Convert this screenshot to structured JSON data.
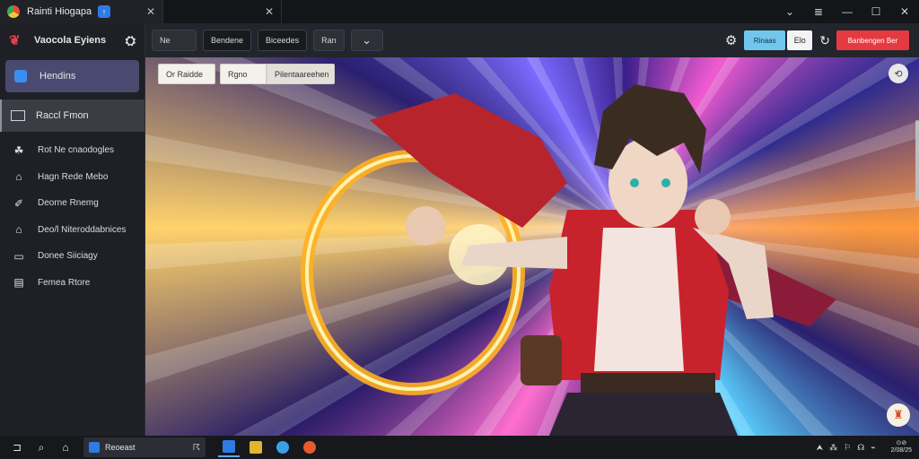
{
  "tabs": [
    {
      "label": "Rainti Hiogapa",
      "badge": "↑",
      "close": "✕"
    },
    {
      "label": "",
      "close": "✕"
    }
  ],
  "window_controls": {
    "chevron": "⌄",
    "menu": "≣",
    "minimize": "—",
    "maximize": "☐",
    "close": "✕"
  },
  "sidebar": {
    "brand": {
      "label": "Vaocola Eyiens",
      "logo": "❦",
      "icon": "⛭"
    },
    "primary": {
      "label": "Hendins"
    },
    "selected": {
      "label": "Raccl Fmon"
    },
    "items": [
      {
        "label": "Rot Ne cnaodogles",
        "icon": "☘"
      },
      {
        "label": "Hagn Rede Mebo",
        "icon": "⌂"
      },
      {
        "label": "Deorne Rnemg",
        "icon": "✐"
      },
      {
        "label": "Deo/l Niteroddabnices",
        "icon": "⌂"
      },
      {
        "label": "Donee Siiciagy",
        "icon": "▭"
      },
      {
        "label": "Femea Rtore",
        "icon": "▤"
      }
    ]
  },
  "toolbar": {
    "buttons": [
      "Ne",
      "Bendene",
      "Biceedes",
      "Ran"
    ],
    "chevron": "⌄",
    "gear": "⚙",
    "blue_label": "Rinaas",
    "white_label": "Elo",
    "refresh": "↻",
    "red_label": "Banbengen  Ber"
  },
  "canvas": {
    "chips": [
      "Or Raidde",
      "Rgno",
      "Pilentaareehen"
    ],
    "fab_top": "⟲",
    "fab_bottom": "♜"
  },
  "taskbar": {
    "start": "⊐",
    "search_icon": "⌕",
    "widgets": "⌂",
    "search_value": "Reoeast",
    "search_trailing": "☈",
    "apps": [
      {
        "color": "#2f7be6",
        "name": "app-window"
      },
      {
        "color": "#e6b32e",
        "name": "app-folder"
      },
      {
        "color": "#3aa0e8",
        "name": "app-browser"
      },
      {
        "color": "#e85a2c",
        "name": "app-media"
      }
    ],
    "tray": [
      "⮝",
      "⁂",
      "⚐",
      "☊",
      "⌁"
    ],
    "clock_top": "⊙⊘",
    "clock_bottom": "2/08/25"
  },
  "colors": {
    "accent_blue": "#71c6ee",
    "accent_red": "#e53a40",
    "sidebar_active": "#4a4a70"
  }
}
